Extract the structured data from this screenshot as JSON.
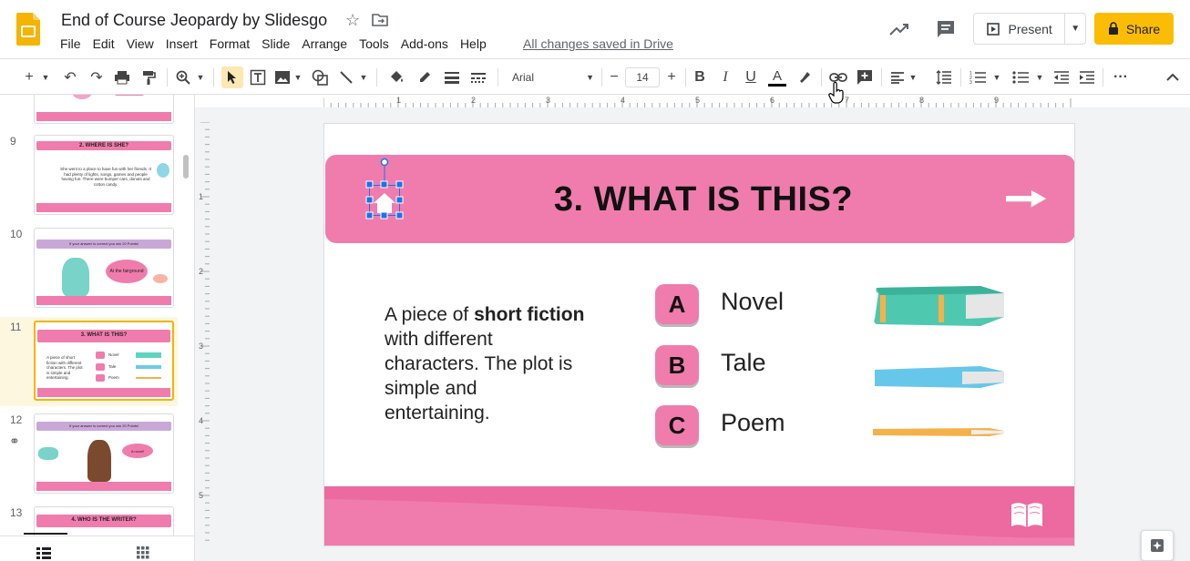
{
  "app": {
    "doc_title": "End of Course Jeopardy by Slidesgo",
    "save_status": "All changes saved in Drive"
  },
  "menu": [
    "File",
    "Edit",
    "View",
    "Insert",
    "Format",
    "Slide",
    "Arrange",
    "Tools",
    "Add-ons",
    "Help"
  ],
  "header_actions": {
    "present_label": "Present",
    "share_label": "Share"
  },
  "toolbar": {
    "font_name": "Arial",
    "font_size": "14"
  },
  "filmstrip": {
    "slides": [
      {
        "number": "9",
        "title": "2. WHERE IS SHE?",
        "text": "She went to a place to have fun with her friends. It had plenty of lights, songs, games and people having fun. There were bumper cars, donuts and cotton candy."
      },
      {
        "number": "10",
        "banner": "If your answer is correct you win 20 Points!",
        "bubble": "At the fairground"
      },
      {
        "number": "11",
        "title": "3. WHAT IS THIS?",
        "options": [
          "Novel",
          "Tale",
          "Poem"
        ],
        "text": "A piece of short fiction with different characters. The plot is simple and entertaining."
      },
      {
        "number": "12",
        "banner": "If your answer is correct you win 20 Points!",
        "bubble": "A novel!"
      },
      {
        "number": "13",
        "title": "4. WHO IS THE WRITER?"
      }
    ]
  },
  "slide": {
    "title": "3. WHAT IS THIS?",
    "question_pre": "A piece of ",
    "question_bold": "short fiction",
    "question_post": " with different characters. The plot is simple and entertaining.",
    "options": [
      {
        "letter": "A",
        "label": "Novel"
      },
      {
        "letter": "B",
        "label": "Tale"
      },
      {
        "letter": "C",
        "label": "Poem"
      }
    ]
  },
  "ruler": {
    "h_ticks": [
      "1",
      "2",
      "3",
      "4",
      "5",
      "6",
      "7",
      "8",
      "9"
    ],
    "v_ticks": [
      "1",
      "2",
      "3",
      "4",
      "5"
    ]
  },
  "colors": {
    "brand_pink": "#f07cad",
    "share_yellow": "#fbbc04",
    "selection_blue": "#1a73e8"
  }
}
